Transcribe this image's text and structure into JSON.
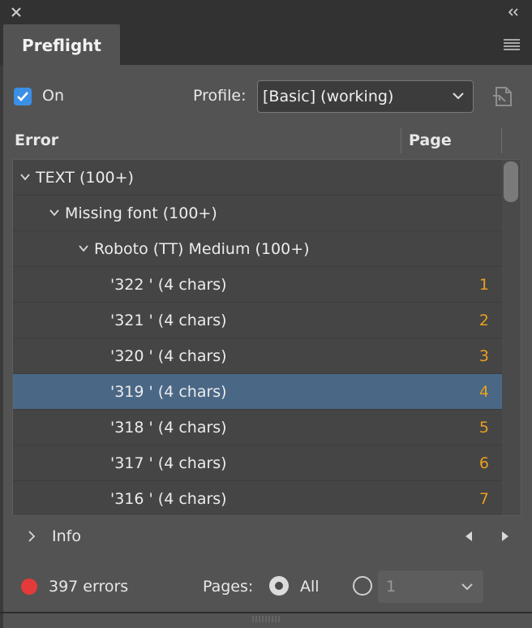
{
  "panel": {
    "tab_title": "Preflight"
  },
  "controls": {
    "on_checked": true,
    "on_label": "On",
    "profile_label": "Profile:",
    "profile_value": "[Basic] (working)"
  },
  "table": {
    "col_error": "Error",
    "col_page": "Page",
    "rows": [
      {
        "label": "TEXT (100+)",
        "page": "",
        "level": 0,
        "expanded": true,
        "selected": false
      },
      {
        "label": "Missing font (100+)",
        "page": "",
        "level": 1,
        "expanded": true,
        "selected": false
      },
      {
        "label": "Roboto (TT) Medium (100+)",
        "page": "",
        "level": 2,
        "expanded": true,
        "selected": false
      },
      {
        "label": "'322 ' (4 chars)",
        "page": "1",
        "level": 3,
        "selected": false
      },
      {
        "label": "'321 ' (4 chars)",
        "page": "2",
        "level": 3,
        "selected": false
      },
      {
        "label": "'320 ' (4 chars)",
        "page": "3",
        "level": 3,
        "selected": false
      },
      {
        "label": "'319 ' (4 chars)",
        "page": "4",
        "level": 3,
        "selected": true
      },
      {
        "label": "'318 ' (4 chars)",
        "page": "5",
        "level": 3,
        "selected": false
      },
      {
        "label": "'317 ' (4 chars)",
        "page": "6",
        "level": 3,
        "selected": false
      },
      {
        "label": "'316 ' (4 chars)",
        "page": "7",
        "level": 3,
        "selected": false
      }
    ]
  },
  "info": {
    "label": "Info"
  },
  "footer": {
    "errors_label": "397 errors",
    "pages_label": "Pages:",
    "all_label": "All",
    "range_value": "1"
  },
  "colors": {
    "accent": "#3b8fe6",
    "error_dot": "#e53a3a",
    "page_number": "#e8a020",
    "selected_row": "#4a6786"
  }
}
